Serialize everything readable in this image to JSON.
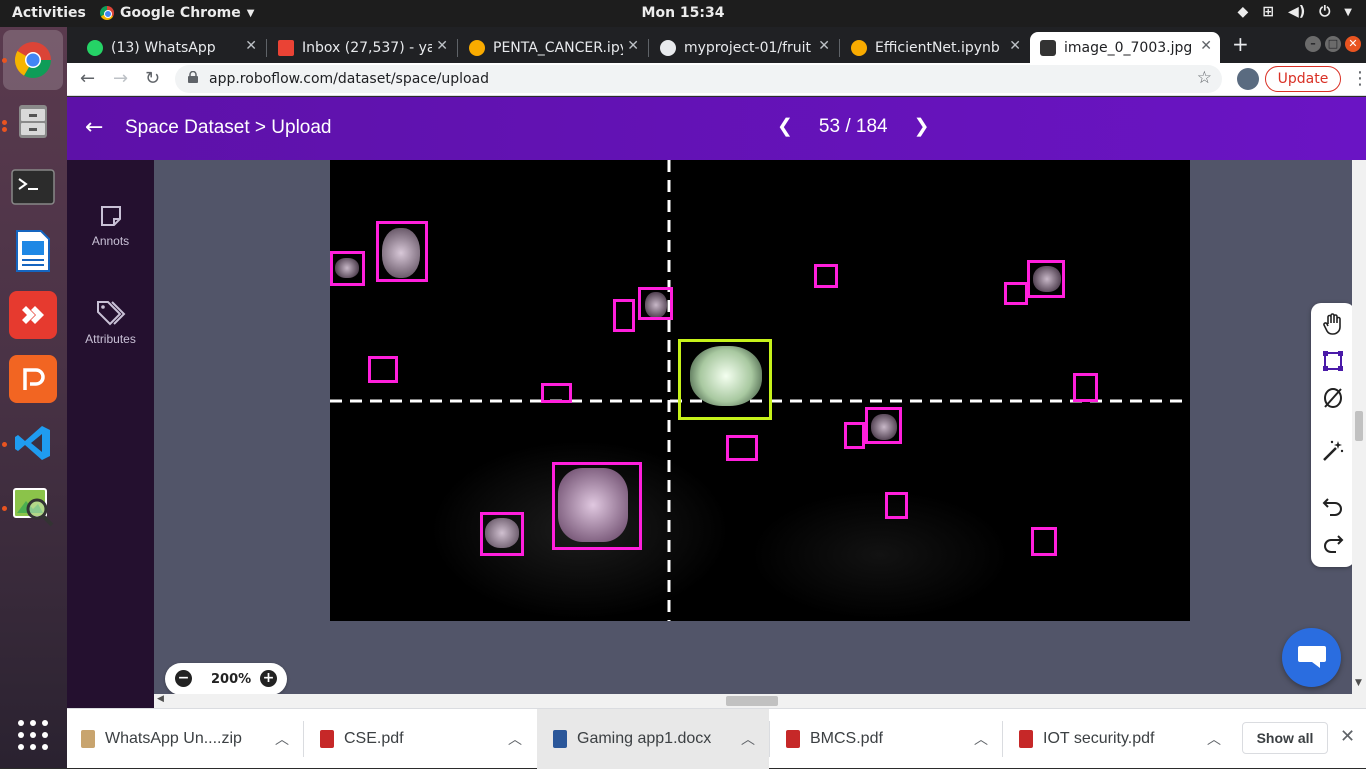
{
  "topbar": {
    "activities": "Activities",
    "app_name": "Google Chrome",
    "clock": "Mon 15:34"
  },
  "tabs": [
    {
      "title": "(13) WhatsApp",
      "icon": "whatsapp-icon",
      "color": "#25d366"
    },
    {
      "title": "Inbox (27,537) - yad",
      "icon": "gmail-icon",
      "color": "#ea4335"
    },
    {
      "title": "PENTA_CANCER.ipy",
      "icon": "colab-icon",
      "color": "#f9ab00"
    },
    {
      "title": "myproject-01/fruit",
      "icon": "github-icon",
      "color": "#e8eaed"
    },
    {
      "title": "EfficientNet.ipynb",
      "icon": "colab-icon",
      "color": "#f9ab00"
    },
    {
      "title": "image_0_7003.jpg",
      "icon": "roboflow-icon",
      "color": "#333333",
      "active": true
    }
  ],
  "toolbar": {
    "url": "app.roboflow.com/dataset/space/upload",
    "update_label": "Update"
  },
  "header": {
    "title": "Space Dataset > Upload",
    "pager": "53 / 184"
  },
  "sidebar": {
    "items": [
      {
        "label": "Annots",
        "icon": "note-icon"
      },
      {
        "label": "Attributes",
        "icon": "tag-icon"
      }
    ]
  },
  "zoom": {
    "value": "200%"
  },
  "downloads": [
    {
      "name": "WhatsApp Un....zip",
      "icon": "zip-icon",
      "color": "#c8a46e"
    },
    {
      "name": "CSE.pdf",
      "icon": "pdf-icon",
      "color": "#c62828"
    },
    {
      "name": "Gaming app1.docx",
      "icon": "docx-icon",
      "color": "#2b579a"
    },
    {
      "name": "BMCS.pdf",
      "icon": "pdf-icon",
      "color": "#c62828"
    },
    {
      "name": "IOT security.pdf",
      "icon": "pdf-icon",
      "color": "#c62828"
    }
  ],
  "show_all_label": "Show all",
  "colors": {
    "brand_purple": "#6a14c4",
    "bbox_magenta": "#ff1fdc",
    "bbox_selected": "#c6f21a",
    "chat_blue": "#2a6de0"
  }
}
